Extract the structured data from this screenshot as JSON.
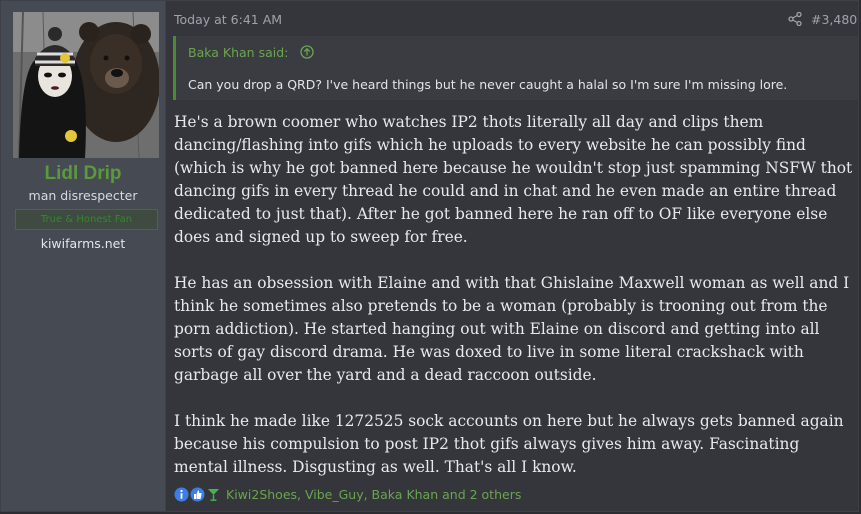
{
  "user": {
    "name": "Lidl Drip",
    "title": "man disrespecter",
    "banner": "True & Honest Fan",
    "site": "kiwifarms.net"
  },
  "post": {
    "date": "Today at 6:41 AM",
    "number": "#3,480",
    "quote": {
      "author": "Baka Khan said:",
      "text": "Can you drop a QRD? I've heard things but he never caught a halal so I'm sure I'm missing lore."
    },
    "paragraphs": [
      "He's a brown coomer who watches IP2 thots literally all day and clips them dancing/flashing into gifs which he uploads to every website he can possibly find (which is why he got banned here because he wouldn't stop just spamming NSFW thot dancing gifs in every thread he could and in chat and he even made an entire thread dedicated to just that). After he got banned here he ran off to OF like everyone else does and signed up to sweep for free.",
      "He has an obsession with Elaine and with that Ghislaine Maxwell woman as well and I think he sometimes also pretends to be a woman (probably is trooning out from the porn addiction). He started hanging out with Elaine on discord and getting into all sorts of gay discord drama. He was doxed to live in some literal crackshack with garbage all over the yard and a dead raccoon outside.",
      "I think he made like 1272525 sock accounts on here but he always gets banned again because his compulsion to post IP2 thot gifs always gives him away. Fascinating mental illness. Disgusting as well. That's all I know."
    ],
    "reactions": {
      "icons": [
        "informative-icon",
        "thumbs-up-icon",
        "cocktail-icon"
      ],
      "users": "Kiwi2Shoes, Vibe_Guy, Baka Khan and 2 others"
    }
  },
  "colors": {
    "username": "#5b9a3b",
    "link": "#6aa54e",
    "quote_border": "#4c8b35",
    "user_cell_bg": "#464a53",
    "post_bg": "#34363c"
  }
}
